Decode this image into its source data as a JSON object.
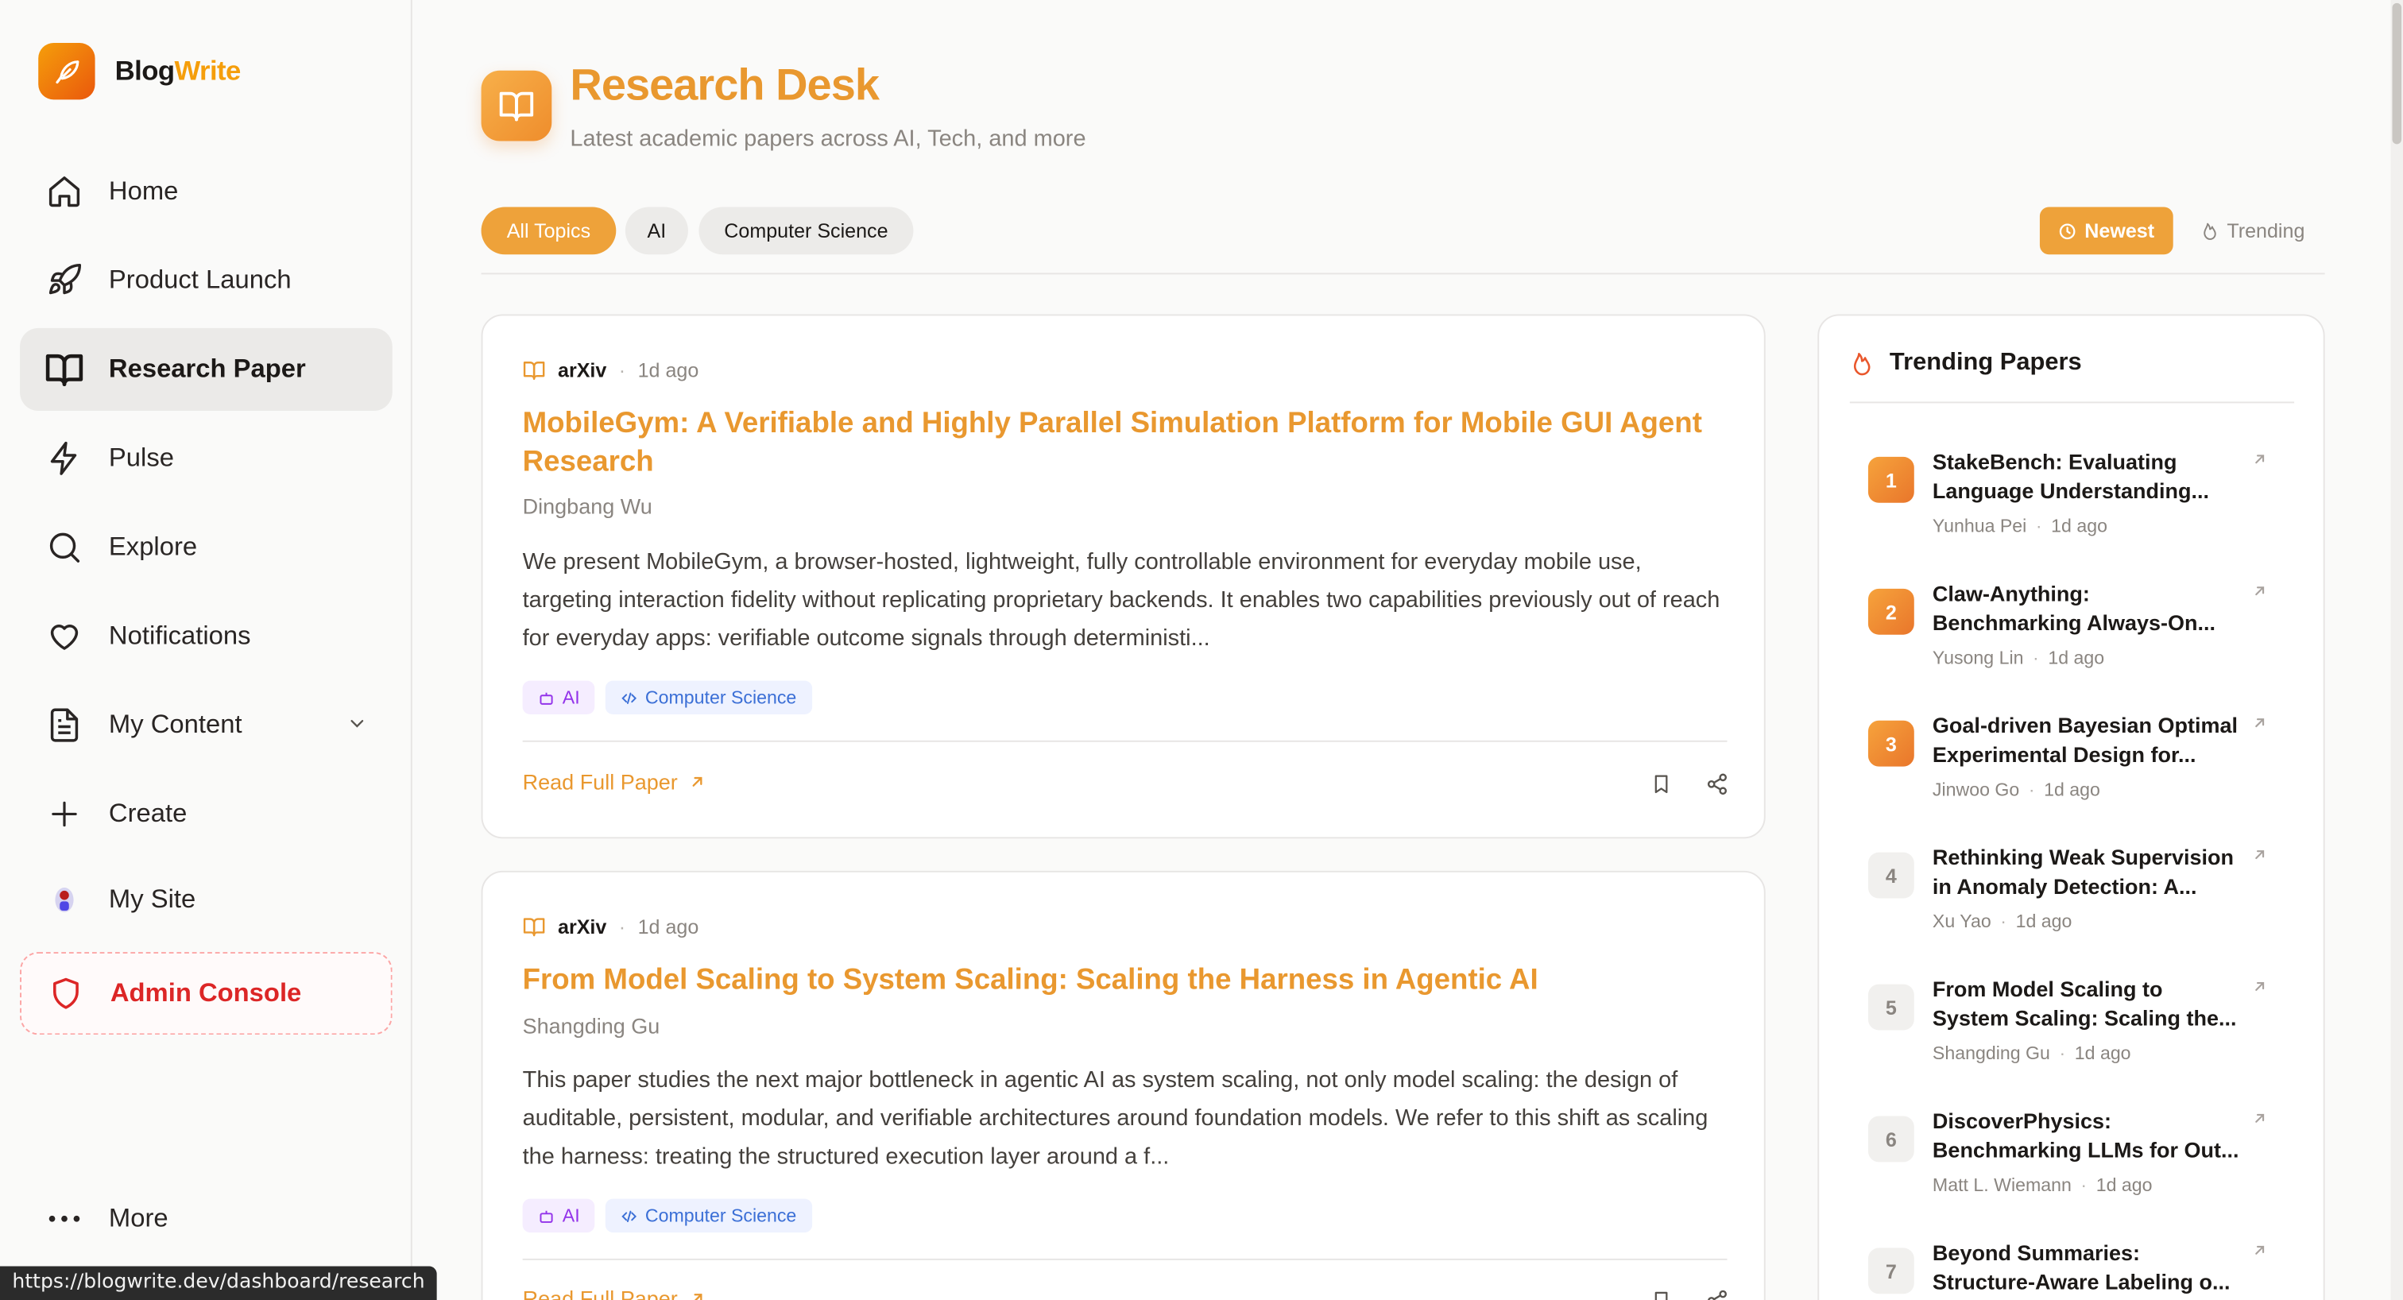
{
  "brand": {
    "name_part1": "Blog",
    "name_part2": "Write"
  },
  "sidebar": {
    "items": [
      {
        "label": "Home",
        "icon": "home-icon"
      },
      {
        "label": "Product Launch",
        "icon": "rocket-icon"
      },
      {
        "label": "Research Paper",
        "icon": "book-open-icon",
        "active": true
      },
      {
        "label": "Pulse",
        "icon": "lightning-icon"
      },
      {
        "label": "Explore",
        "icon": "search-icon"
      },
      {
        "label": "Notifications",
        "icon": "heart-icon"
      },
      {
        "label": "My Content",
        "icon": "document-icon"
      },
      {
        "label": "Create",
        "icon": "plus-icon"
      },
      {
        "label": "My Site",
        "icon": "site-avatar-icon"
      },
      {
        "label": "Admin Console",
        "icon": "shield-icon"
      },
      {
        "label": "More",
        "icon": "more-dots-icon"
      }
    ]
  },
  "status_url": "https://blogwrite.dev/dashboard/research",
  "header": {
    "title": "Research Desk",
    "subtitle": "Latest academic papers across AI, Tech, and more"
  },
  "filters": {
    "chips": [
      "All Topics",
      "AI",
      "Computer Science"
    ],
    "sort_newest": "Newest",
    "sort_trending": "Trending"
  },
  "papers": [
    {
      "source": "arXiv",
      "time": "1d ago",
      "title": "MobileGym: A Verifiable and Highly Parallel Simulation Platform for Mobile GUI Agent Research",
      "author": "Dingbang Wu",
      "abstract": "We present MobileGym, a browser-hosted, lightweight, fully controllable environment for everyday mobile use, targeting interaction fidelity without replicating proprietary backends. It enables two capabilities previously out of reach for everyday apps: verifiable outcome signals through deterministi...",
      "tags": [
        "AI",
        "Computer Science"
      ],
      "read_label": "Read Full Paper"
    },
    {
      "source": "arXiv",
      "time": "1d ago",
      "title": "From Model Scaling to System Scaling: Scaling the Harness in Agentic AI",
      "author": "Shangding Gu",
      "abstract": "This paper studies the next major bottleneck in agentic AI as system scaling, not only model scaling: the design of auditable, persistent, modular, and verifiable architectures around foundation models. We refer to this shift as scaling the harness: treating the structured execution layer around a f...",
      "tags": [
        "AI",
        "Computer Science"
      ],
      "read_label": "Read Full Paper"
    }
  ],
  "trending": {
    "title": "Trending Papers",
    "items": [
      {
        "rank": "1",
        "title": "StakeBench: Evaluating Language Understanding...",
        "author": "Yunhua Pei",
        "time": "1d ago"
      },
      {
        "rank": "2",
        "title": "Claw-Anything: Benchmarking Always-On...",
        "author": "Yusong Lin",
        "time": "1d ago"
      },
      {
        "rank": "3",
        "title": "Goal-driven Bayesian Optimal Experimental Design for...",
        "author": "Jinwoo Go",
        "time": "1d ago"
      },
      {
        "rank": "4",
        "title": "Rethinking Weak Supervision in Anomaly Detection: A...",
        "author": "Xu Yao",
        "time": "1d ago"
      },
      {
        "rank": "5",
        "title": "From Model Scaling to System Scaling: Scaling the...",
        "author": "Shangding Gu",
        "time": "1d ago"
      },
      {
        "rank": "6",
        "title": "DiscoverPhysics: Benchmarking LLMs for Out...",
        "author": "Matt L. Wiemann",
        "time": "1d ago"
      },
      {
        "rank": "7",
        "title": "Beyond Summaries: Structure-Aware Labeling o...",
        "author": "",
        "time": ""
      }
    ]
  },
  "colors": {
    "accent": "#e9982f",
    "accent_bg": "#eea23a",
    "admin": "#dc2626",
    "ai_tag": "#9333ea",
    "cs_tag": "#3b6fd6"
  }
}
